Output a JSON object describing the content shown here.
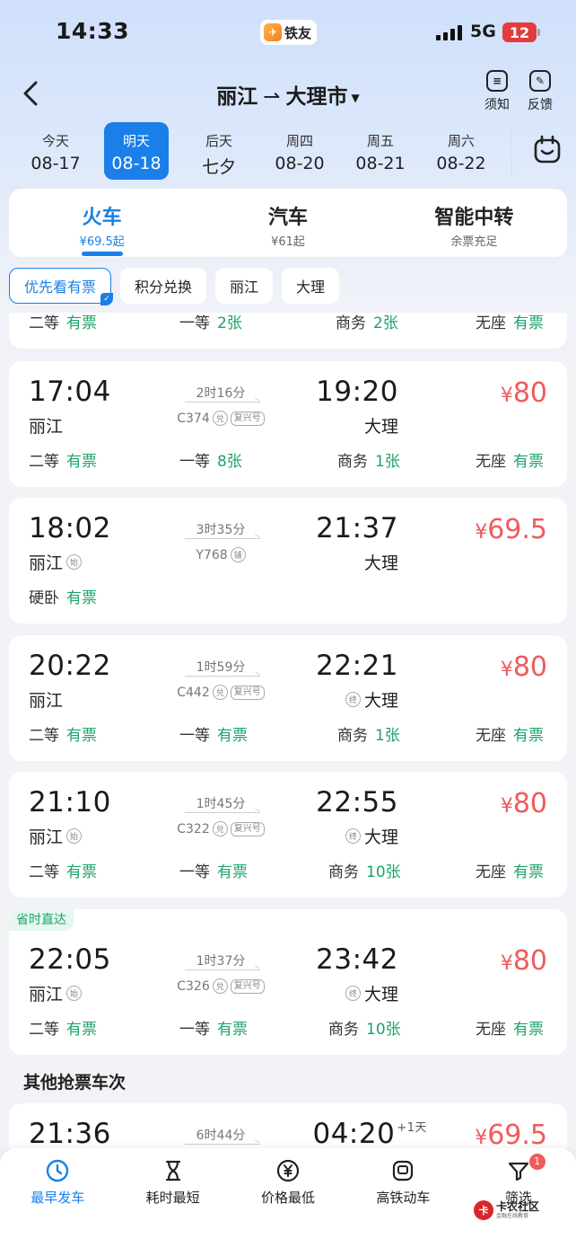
{
  "status_bar": {
    "time": "14:33",
    "app_name": "铁友",
    "network": "5G",
    "battery": "12"
  },
  "header": {
    "from": "丽江",
    "arrow": "⇀",
    "to": "大理市",
    "notice_label": "须知",
    "feedback_label": "反馈"
  },
  "dates": [
    {
      "day": "今天",
      "date": "08-17"
    },
    {
      "day": "明天",
      "date": "08-18"
    },
    {
      "day": "后天",
      "date": "七夕"
    },
    {
      "day": "周四",
      "date": "08-20"
    },
    {
      "day": "周五",
      "date": "08-21"
    },
    {
      "day": "周六",
      "date": "08-22"
    }
  ],
  "modes": [
    {
      "label": "火车",
      "sub": "¥69.5起"
    },
    {
      "label": "汽车",
      "sub": "¥61起"
    },
    {
      "label": "智能中转",
      "sub": "余票充足"
    }
  ],
  "chips": [
    "优先看有票",
    "积分兑换",
    "丽江",
    "大理"
  ],
  "partial_row": {
    "s1_name": "二等",
    "s1_val": "有票",
    "s2_name": "一等",
    "s2_val": "2张",
    "s3_name": "商务",
    "s3_val": "2张",
    "s4_name": "无座",
    "s4_val": "有票"
  },
  "trains": [
    {
      "dep_time": "17:04",
      "dep_station": "丽江",
      "dep_tag": "",
      "arr_time": "19:20",
      "arr_station": "大理",
      "arr_tag": "",
      "duration": "2时16分",
      "train_no": "C374",
      "tag1": "兑",
      "tag2": "复兴号",
      "price_symbol": "¥",
      "price": "80",
      "s1_name": "二等",
      "s1_val": "有票",
      "s2_name": "一等",
      "s2_val": "8张",
      "s3_name": "商务",
      "s3_val": "1张",
      "s4_name": "无座",
      "s4_val": "有票"
    },
    {
      "dep_time": "18:02",
      "dep_station": "丽江",
      "dep_tag": "始",
      "arr_time": "21:37",
      "arr_station": "大理",
      "arr_tag": "",
      "duration": "3时35分",
      "train_no": "Y768",
      "tag1": "铺",
      "tag2": "",
      "price_symbol": "¥",
      "price": "69.5",
      "s1_name": "硬卧",
      "s1_val": "有票"
    },
    {
      "dep_time": "20:22",
      "dep_station": "丽江",
      "dep_tag": "",
      "arr_time": "22:21",
      "arr_station": "大理",
      "arr_tag": "终",
      "duration": "1时59分",
      "train_no": "C442",
      "tag1": "兑",
      "tag2": "复兴号",
      "price_symbol": "¥",
      "price": "80",
      "s1_name": "二等",
      "s1_val": "有票",
      "s2_name": "一等",
      "s2_val": "有票",
      "s3_name": "商务",
      "s3_val": "1张",
      "s4_name": "无座",
      "s4_val": "有票"
    },
    {
      "dep_time": "21:10",
      "dep_station": "丽江",
      "dep_tag": "始",
      "arr_time": "22:55",
      "arr_station": "大理",
      "arr_tag": "终",
      "duration": "1时45分",
      "train_no": "C322",
      "tag1": "兑",
      "tag2": "复兴号",
      "price_symbol": "¥",
      "price": "80",
      "s1_name": "二等",
      "s1_val": "有票",
      "s2_name": "一等",
      "s2_val": "有票",
      "s3_name": "商务",
      "s3_val": "10张",
      "s4_name": "无座",
      "s4_val": "有票"
    },
    {
      "promo": "省时直达",
      "dep_time": "22:05",
      "dep_station": "丽江",
      "dep_tag": "始",
      "arr_time": "23:42",
      "arr_station": "大理",
      "arr_tag": "终",
      "duration": "1时37分",
      "train_no": "C326",
      "tag1": "兑",
      "tag2": "复兴号",
      "price_symbol": "¥",
      "price": "80",
      "s1_name": "二等",
      "s1_val": "有票",
      "s2_name": "一等",
      "s2_val": "有票",
      "s3_name": "商务",
      "s3_val": "10张",
      "s4_name": "无座",
      "s4_val": "有票"
    }
  ],
  "other_section_title": "其他抢票车次",
  "other_train": {
    "dep_time": "21:36",
    "duration": "6时44分",
    "arr_time": "04:20",
    "plus_day": "+1天",
    "price_symbol": "¥",
    "price": "69.5"
  },
  "bottom_nav": [
    {
      "label": "最早发车",
      "icon": "clock-icon"
    },
    {
      "label": "耗时最短",
      "icon": "hourglass-icon"
    },
    {
      "label": "价格最低",
      "icon": "yen-icon"
    },
    {
      "label": "高铁动车",
      "icon": "train-icon"
    },
    {
      "label": "筛选",
      "icon": "filter-icon"
    }
  ],
  "filter_badge": "1",
  "watermark": {
    "main": "卡农社区",
    "sub": "金融在线教育"
  },
  "colors": {
    "accent": "#1a7fe8",
    "price": "#f05b5b",
    "available": "#1ea36a"
  }
}
